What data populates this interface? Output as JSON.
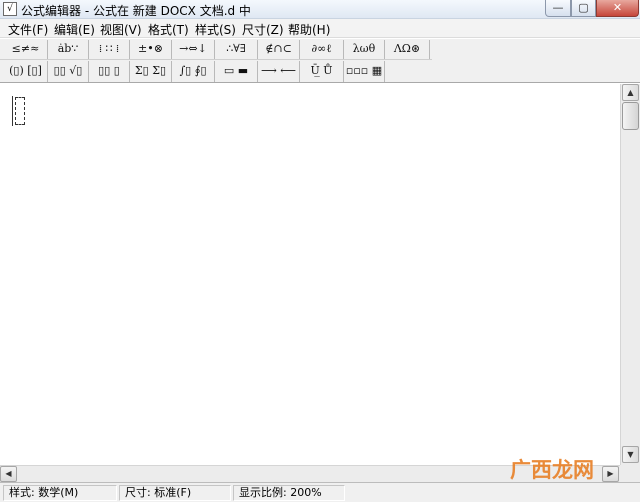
{
  "window": {
    "title": "公式编辑器 - 公式在 新建 DOCX 文档.d 中",
    "min_symbol": "—",
    "max_symbol": "▢",
    "close_symbol": "✕"
  },
  "menu": [
    "文件(F)",
    "编辑(E)",
    "视图(V)",
    "格式(T)",
    "样式(S)",
    "尺寸(Z)",
    "帮助(H)"
  ],
  "toolbar_row1": [
    "≤≠≈",
    "ȧb∵",
    "⁞ ∷ ⁞",
    "±•⊗",
    "→⇔↓",
    "∴∀∃",
    "∉∩⊂",
    "∂∞ℓ",
    "λωθ",
    "ΛΩ⊛"
  ],
  "toolbar_row2": [
    "(▯) [▯]",
    "▯▯ √▯",
    "▯▯ ▯",
    "Σ▯ Σ▯",
    "∫▯ ∮▯",
    "▭ ▬",
    "⟶ ⟵",
    "Ū̲ Ů",
    "▫▫▫ ▦"
  ],
  "scrollbar": {
    "up": "▲",
    "down": "▼",
    "left": "◀",
    "right": "▶"
  },
  "status": {
    "style": "样式: 数学(M)",
    "size": "尺寸: 标准(F)",
    "zoom": "显示比例: 200%"
  },
  "watermark": "广西龙网"
}
